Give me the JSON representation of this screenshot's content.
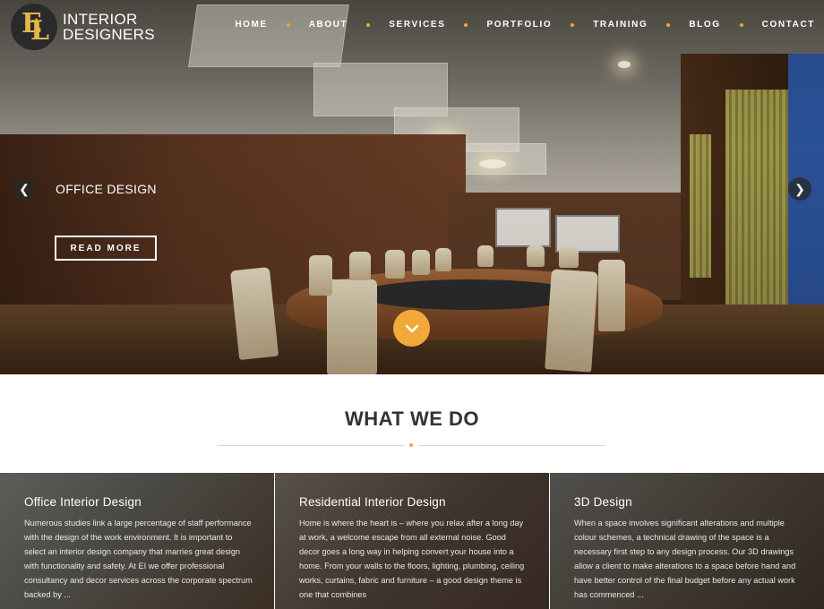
{
  "brand": {
    "line1": "INTERIOR",
    "line2": "DESIGNERS",
    "monogram": "EL"
  },
  "nav": [
    "HOME",
    "ABOUT",
    "SERVICES",
    "PORTFOLIO",
    "TRAINING",
    "BLOG",
    "CONTACT"
  ],
  "slide": {
    "title": "OFFICE DESIGN",
    "button": "READ MORE"
  },
  "section": {
    "title": "WHAT WE DO"
  },
  "cards": [
    {
      "title": "Office Interior Design",
      "text": "Numerous studies link a large percentage of staff performance with the design of the work environment. It is important to select an interior design company that marries great design with functionality and safety. At EI we offer professional consultancy and decor services across the corporate spectrum backed by ..."
    },
    {
      "title": "Residential Interior Design",
      "text": "Home is where the heart is – where you relax after a long day at work, a welcome escape from all external noise. Good decor goes a long way in helping convert your house into a home. From your walls to the floors, lighting, plumbing, ceiling works, curtains, fabric and furniture – a good design theme is one that combines"
    },
    {
      "title": "3D Design",
      "text": "When a space involves significant alterations and multiple colour schemes, a technical drawing of the space is a necessary first step to any design process. Our 3D drawings allow a client to make alterations to a space before hand and have better control of the final budget before any actual work has commenced ..."
    }
  ],
  "colors": {
    "accent": "#f2a93a",
    "logo_gold": "#e2b64a"
  }
}
